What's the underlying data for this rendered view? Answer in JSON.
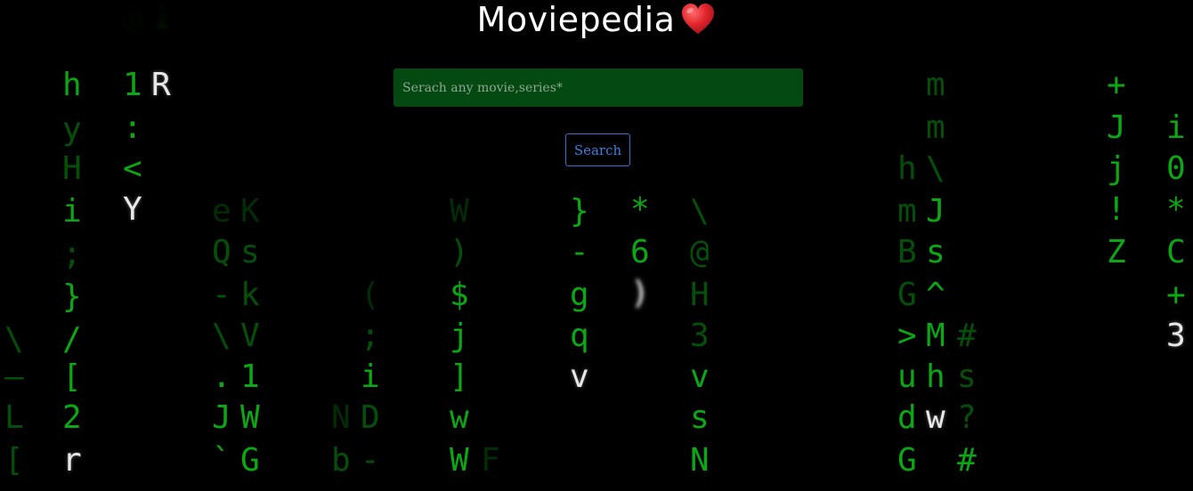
{
  "header": {
    "title": "Moviepedia"
  },
  "search": {
    "placeholder": "Serach any movie,series*",
    "value": "",
    "button_label": "Search"
  },
  "colors": {
    "rain_green": "#0aa812",
    "input_background": "#044911",
    "button_border": "#2f6fd0",
    "button_text": "#3d7ee0",
    "heart": "#e0242b"
  },
  "icons": {
    "heart": "red-heart-icon"
  },
  "rain": [
    {
      "c": "h",
      "s": ""
    },
    {
      "c": "y",
      "s": "dim"
    },
    {
      "c": "H",
      "s": "dim"
    },
    {
      "c": "i",
      "s": ""
    },
    {
      "c": ";",
      "s": "dim"
    },
    {
      "c": "}",
      "s": ""
    },
    {
      "c": "/",
      "s": ""
    },
    {
      "c": "[",
      "s": ""
    },
    {
      "c": "2",
      "s": ""
    },
    {
      "c": "r",
      "s": "head"
    },
    {
      "c": "\\",
      "s": "dim"
    },
    {
      "c": "—",
      "s": "dim"
    },
    {
      "c": "L",
      "s": "dim"
    },
    {
      "c": "[",
      "s": "dim"
    },
    {
      "c": "@",
      "s": "dim blur"
    },
    {
      "c": "1",
      "s": "blur"
    },
    {
      "c": "1",
      "s": ""
    },
    {
      "c": "R",
      "s": "head"
    },
    {
      "c": ":",
      "s": ""
    },
    {
      "c": "<",
      "s": ""
    },
    {
      "c": "Y",
      "s": "head"
    },
    {
      "c": "e",
      "s": "faint"
    },
    {
      "c": "K",
      "s": "faint"
    },
    {
      "c": "Q",
      "s": "dim"
    },
    {
      "c": "s",
      "s": "dim"
    },
    {
      "c": "-",
      "s": "dim"
    },
    {
      "c": "k",
      "s": "dim"
    },
    {
      "c": "\\",
      "s": "dim"
    },
    {
      "c": "V",
      "s": "dim"
    },
    {
      "c": ".",
      "s": ""
    },
    {
      "c": "1",
      "s": ""
    },
    {
      "c": "J",
      "s": ""
    },
    {
      "c": "W",
      "s": ""
    },
    {
      "c": "`",
      "s": ""
    },
    {
      "c": "G",
      "s": ""
    },
    {
      "c": "(",
      "s": "faint"
    },
    {
      "c": ";",
      "s": "dim"
    },
    {
      "c": "i",
      "s": ""
    },
    {
      "c": "N",
      "s": "faint"
    },
    {
      "c": "D",
      "s": "dim"
    },
    {
      "c": "b",
      "s": "dim"
    },
    {
      "c": "-",
      "s": "dim"
    },
    {
      "c": "W",
      "s": "faint"
    },
    {
      "c": ")",
      "s": "dim"
    },
    {
      "c": "$",
      "s": ""
    },
    {
      "c": "j",
      "s": ""
    },
    {
      "c": "]",
      "s": ""
    },
    {
      "c": "w",
      "s": ""
    },
    {
      "c": "W",
      "s": ""
    },
    {
      "c": "F",
      "s": "faint"
    },
    {
      "c": "}",
      "s": ""
    },
    {
      "c": "-",
      "s": ""
    },
    {
      "c": "g",
      "s": ""
    },
    {
      "c": "q",
      "s": ""
    },
    {
      "c": "v",
      "s": "head"
    },
    {
      "c": "*",
      "s": ""
    },
    {
      "c": "6",
      "s": ""
    },
    {
      "c": ")",
      "s": "head blur"
    },
    {
      "c": "\\",
      "s": "dim"
    },
    {
      "c": "@",
      "s": "dim"
    },
    {
      "c": "H",
      "s": "dim"
    },
    {
      "c": "3",
      "s": "dim"
    },
    {
      "c": "v",
      "s": ""
    },
    {
      "c": "s",
      "s": ""
    },
    {
      "c": "N",
      "s": ""
    },
    {
      "c": "m",
      "s": "dim"
    },
    {
      "c": "m",
      "s": "dim"
    },
    {
      "c": "h",
      "s": "dim"
    },
    {
      "c": "\\",
      "s": "dim"
    },
    {
      "c": "m",
      "s": "dim"
    },
    {
      "c": "J",
      "s": ""
    },
    {
      "c": "B",
      "s": "dim"
    },
    {
      "c": "s",
      "s": ""
    },
    {
      "c": "G",
      "s": "dim"
    },
    {
      "c": "^",
      "s": ""
    },
    {
      "c": ">",
      "s": ""
    },
    {
      "c": "M",
      "s": ""
    },
    {
      "c": "#",
      "s": "dim"
    },
    {
      "c": "u",
      "s": ""
    },
    {
      "c": "h",
      "s": ""
    },
    {
      "c": "s",
      "s": "dim"
    },
    {
      "c": "d",
      "s": ""
    },
    {
      "c": "w",
      "s": "head"
    },
    {
      "c": "?",
      "s": "dim"
    },
    {
      "c": "G",
      "s": ""
    },
    {
      "c": "#",
      "s": ""
    },
    {
      "c": "+",
      "s": ""
    },
    {
      "c": "J",
      "s": ""
    },
    {
      "c": "j",
      "s": ""
    },
    {
      "c": "!",
      "s": ""
    },
    {
      "c": "Z",
      "s": ""
    },
    {
      "c": "i",
      "s": ""
    },
    {
      "c": "0",
      "s": ""
    },
    {
      "c": "*",
      "s": ""
    },
    {
      "c": "C",
      "s": ""
    },
    {
      "c": "+",
      "s": ""
    },
    {
      "c": "3",
      "s": "head"
    }
  ]
}
